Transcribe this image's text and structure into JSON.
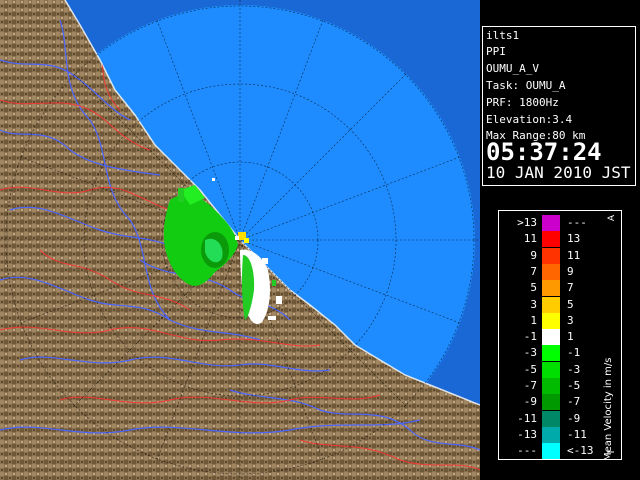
{
  "info": {
    "site": "ilts1",
    "product": "PPI",
    "volume": "OUMU_A_V",
    "task": "Task: OUMU_A",
    "prf": "PRF: 1800Hz",
    "elevation": "Elevation:3.4",
    "max_range": "Max Range:80 km",
    "time": "05:37:24",
    "date": "10 JAN 2010 JST"
  },
  "legend": {
    "unit_label": "Mean Velocity in m/s",
    "corner_top": "A",
    "corner_bottom": "T",
    "bins": [
      {
        "left": ">13",
        "right": "---",
        "color": "#cc00cc"
      },
      {
        "left": "11",
        "right": "13",
        "color": "#ff0000"
      },
      {
        "left": "9",
        "right": "11",
        "color": "#ff3300"
      },
      {
        "left": "7",
        "right": "9",
        "color": "#ff6600"
      },
      {
        "left": "5",
        "right": "7",
        "color": "#ff9900"
      },
      {
        "left": "3",
        "right": "5",
        "color": "#ffcc00"
      },
      {
        "left": "1",
        "right": "3",
        "color": "#ffff00"
      },
      {
        "left": "-1",
        "right": "1",
        "color": "#ffffff"
      },
      {
        "left": "-3",
        "right": "-1",
        "color": "#00ff00"
      },
      {
        "left": "-5",
        "right": "-3",
        "color": "#00dd00"
      },
      {
        "left": "-7",
        "right": "-5",
        "color": "#00bb00"
      },
      {
        "left": "-9",
        "right": "-7",
        "color": "#009900"
      },
      {
        "left": "-11",
        "right": "-9",
        "color": "#008866"
      },
      {
        "left": "-13",
        "right": "-11",
        "color": "#00aaaa"
      },
      {
        "left": "---",
        "right": "<-13",
        "color": "#00ffff"
      }
    ]
  },
  "map": {
    "sea_color": "#1e8cff",
    "outer_sea_color": "#1565d8",
    "land_color": "#8a7048",
    "river_color": "#4c66ff",
    "border_color": "#ff3333"
  }
}
